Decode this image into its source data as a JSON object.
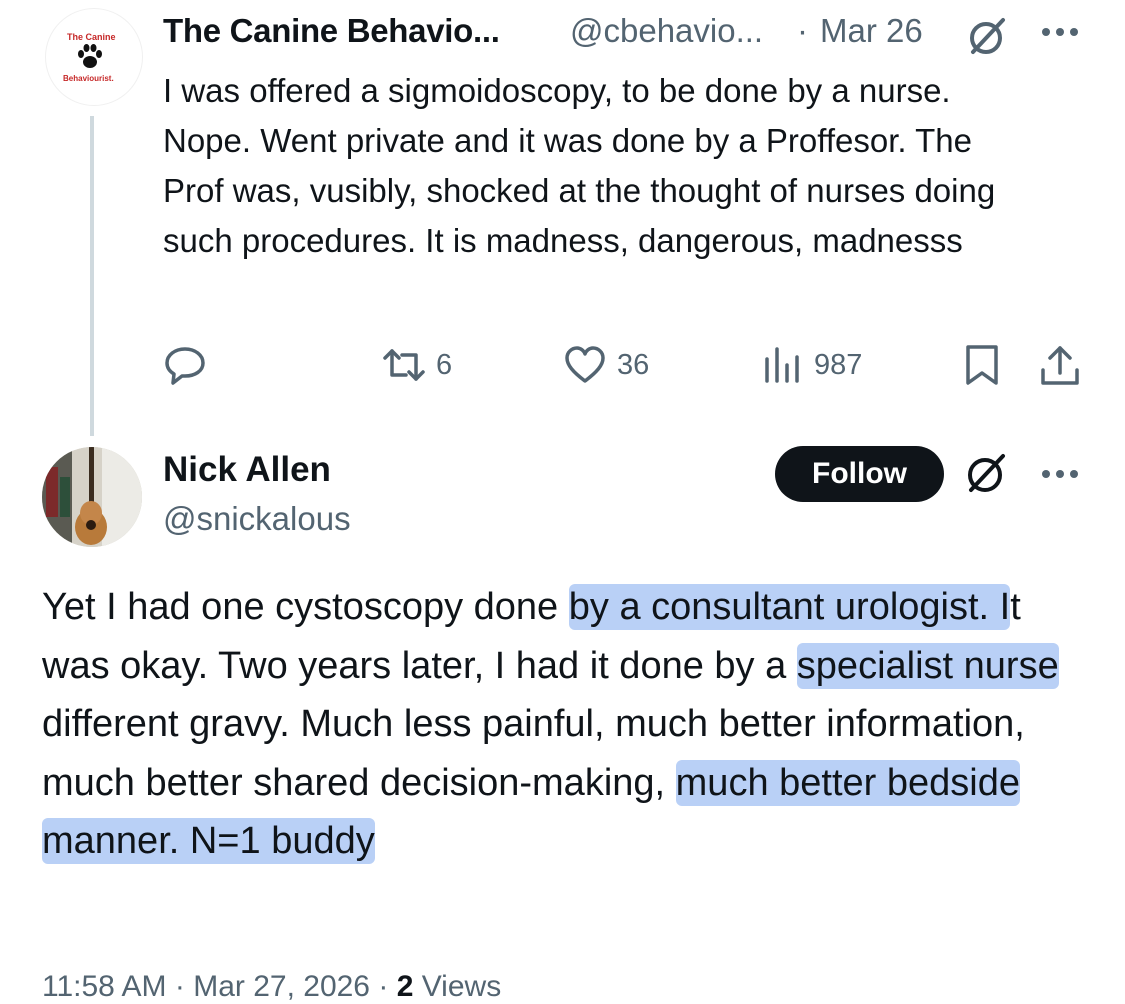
{
  "tweet1": {
    "avatar": {
      "line1": "The Canine",
      "line2": "Behaviourist."
    },
    "display_name": "The Canine Behavio...",
    "handle": "@cbehavio...",
    "separator": "·",
    "date": "Mar 26",
    "text": "I was offered a sigmoidoscopy, to be done by a nurse. Nope. Went private and it was done by a Proffesor. The Prof was, vusibly, shocked at the thought of nurses doing such procedures. It is madness, dangerous, madnesss",
    "reposts": "6",
    "likes": "36",
    "views": "987",
    "icons": [
      "grok-icon",
      "more-icon",
      "reply-icon",
      "repost-icon",
      "like-icon",
      "views-icon",
      "bookmark-icon",
      "share-icon"
    ]
  },
  "tweet2": {
    "display_name": "Nick Allen",
    "handle": "@snickalous",
    "follow_label": "Follow",
    "text_segments": [
      {
        "text": "Yet I had one cystoscopy done ",
        "highlight": false
      },
      {
        "text": "by a consultant urologist. I",
        "highlight": true
      },
      {
        "text": "t was okay. Two years later, I had it done by a ",
        "highlight": false
      },
      {
        "text": "specialist nurse",
        "highlight": true
      },
      {
        "text": " different gravy. Much less painful, much better information, much better shared decision-making, ",
        "highlight": false
      },
      {
        "text": "much better bedside",
        "highlight": true
      },
      {
        "text": " ",
        "highlight": false
      },
      {
        "text": "manner. N=1 buddy",
        "highlight": true
      }
    ],
    "time": "11:58 AM",
    "date": "Mar 27, 2026",
    "views_count": "2",
    "views_label": "Views"
  },
  "colors": {
    "text": "#0f1419",
    "secondary": "#536471",
    "highlight": "#6496eb",
    "follow_bg": "#0f1419"
  }
}
